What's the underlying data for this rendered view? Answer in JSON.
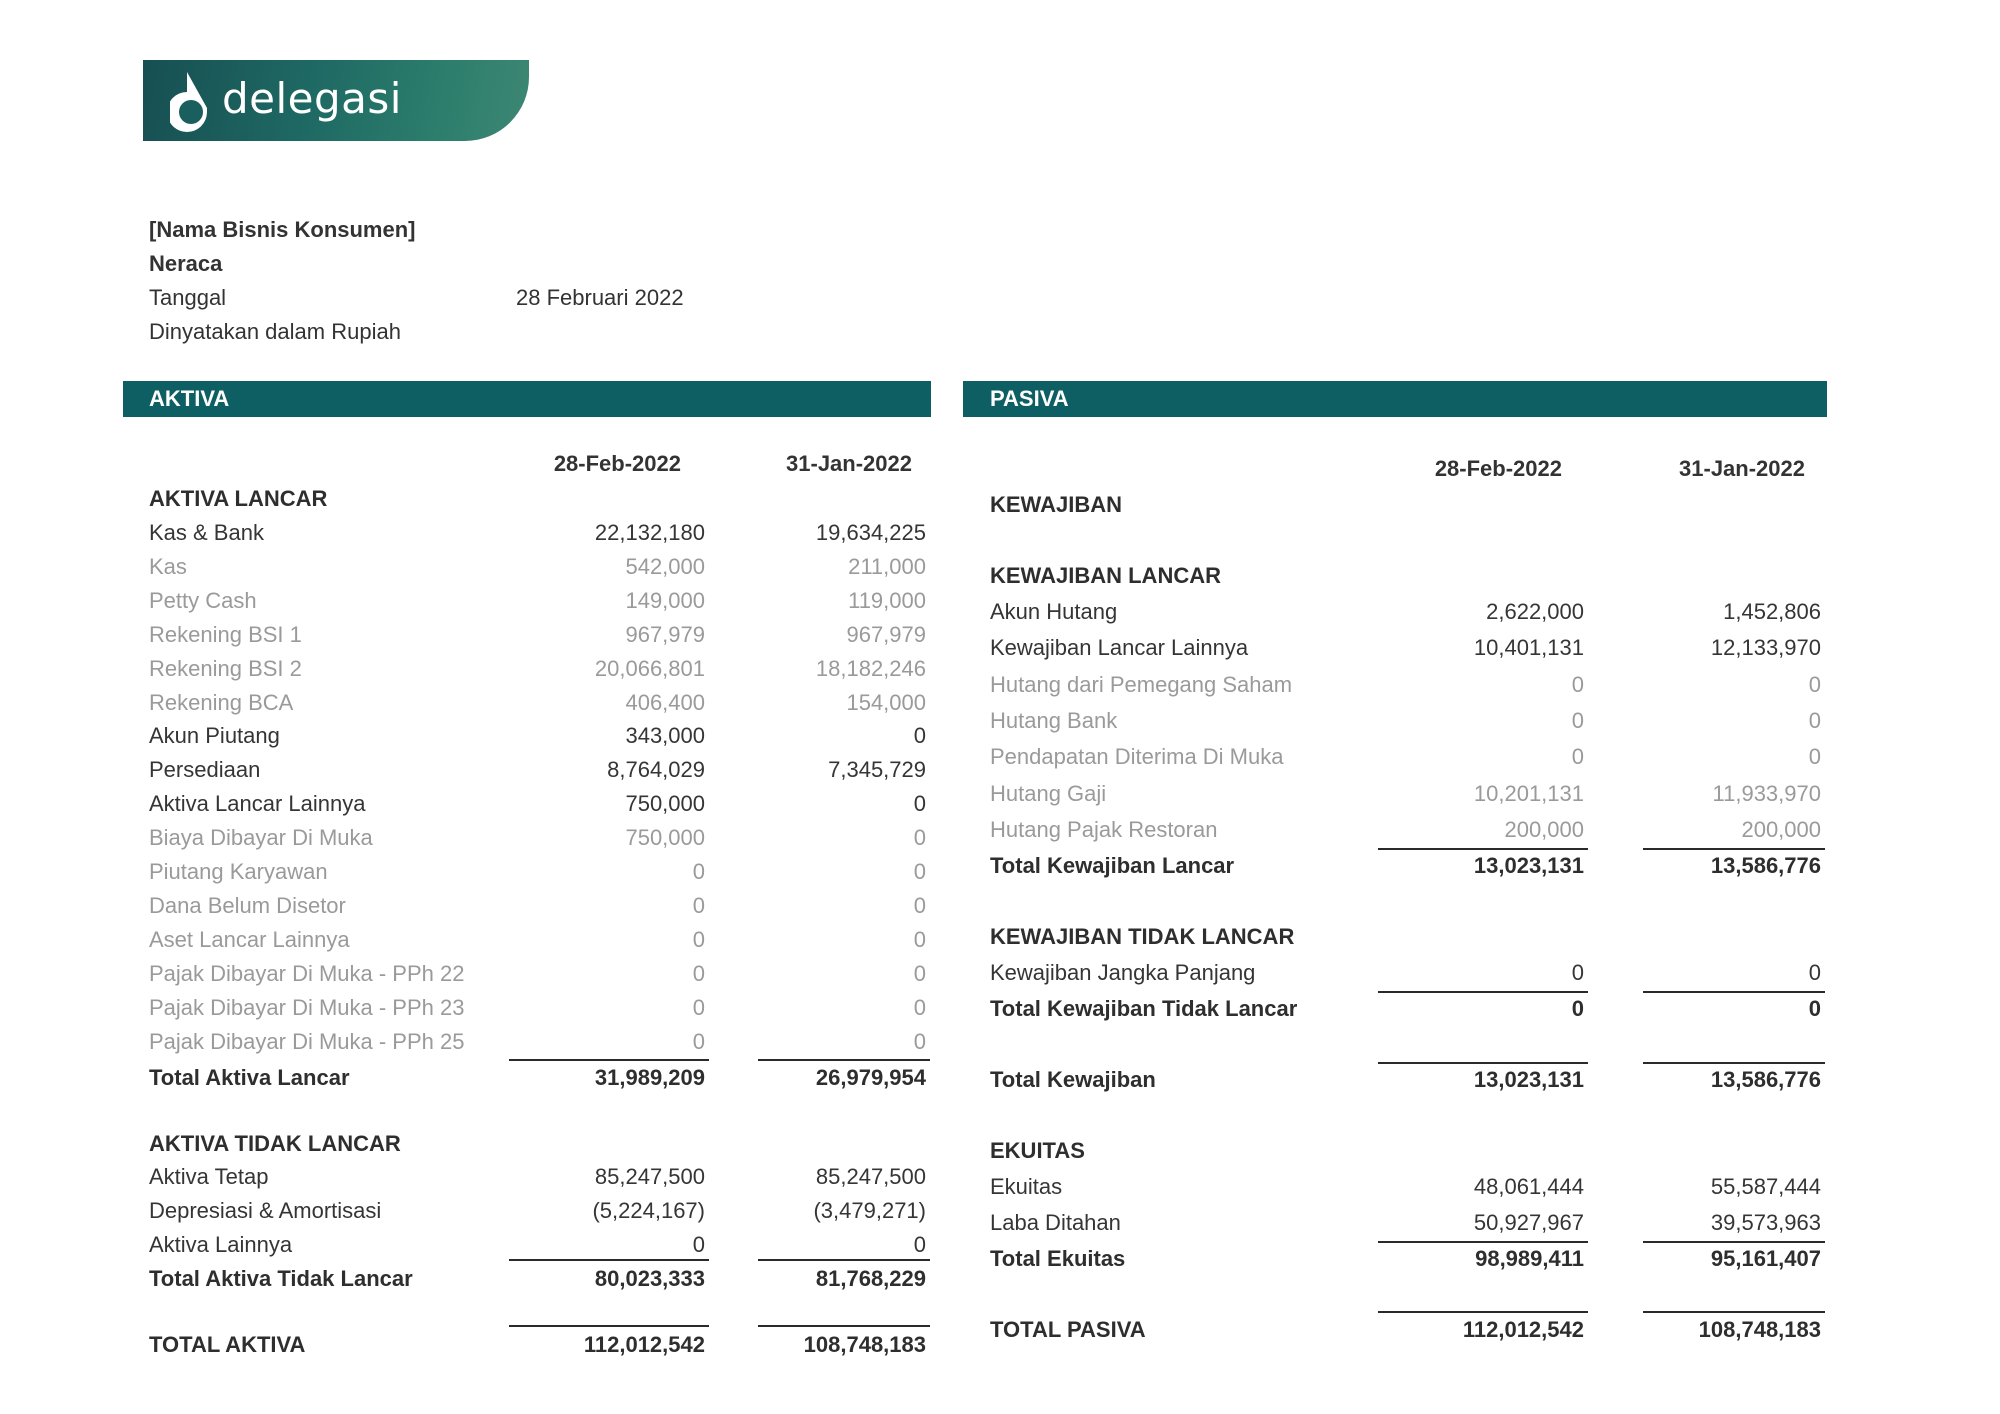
{
  "brand": {
    "name": "delegasi",
    "logo_icon": "delegasi-logo-icon"
  },
  "header": {
    "business_name": "[Nama Bisnis Konsumen]",
    "report_title": "Neraca",
    "date_label": "Tanggal",
    "date_value": "28 Februari 2022",
    "currency_note": "Dinyatakan dalam Rupiah"
  },
  "aktiva": {
    "title": "AKTIVA",
    "col1": "28-Feb-2022",
    "col2": "31-Jan-2022",
    "current_section": "AKTIVA LANCAR",
    "current_rows": [
      {
        "label": "Kas & Bank",
        "v1": "22,132,180",
        "v2": "19,634,225"
      },
      {
        "label": "Kas",
        "v1": "542,000",
        "v2": "211,000"
      },
      {
        "label": "Petty Cash",
        "v1": "149,000",
        "v2": "119,000"
      },
      {
        "label": "Rekening BSI 1",
        "v1": "967,979",
        "v2": "967,979"
      },
      {
        "label": "Rekening BSI 2",
        "v1": "20,066,801",
        "v2": "18,182,246"
      },
      {
        "label": "Rekening BCA",
        "v1": "406,400",
        "v2": "154,000"
      },
      {
        "label": "Akun Piutang",
        "v1": "343,000",
        "v2": "0"
      },
      {
        "label": "Persediaan",
        "v1": "8,764,029",
        "v2": "7,345,729"
      },
      {
        "label": "Aktiva Lancar Lainnya",
        "v1": "750,000",
        "v2": "0"
      },
      {
        "label": "Biaya Dibayar Di Muka",
        "v1": "750,000",
        "v2": "0"
      },
      {
        "label": "Piutang Karyawan",
        "v1": "0",
        "v2": "0"
      },
      {
        "label": "Dana Belum Disetor",
        "v1": "0",
        "v2": "0"
      },
      {
        "label": "Aset Lancar Lainnya",
        "v1": "0",
        "v2": "0"
      },
      {
        "label": "Pajak Dibayar Di Muka - PPh 22",
        "v1": "0",
        "v2": "0"
      },
      {
        "label": "Pajak Dibayar Di Muka - PPh 23",
        "v1": "0",
        "v2": "0"
      },
      {
        "label": "Pajak Dibayar Di Muka - PPh 25",
        "v1": "0",
        "v2": "0"
      }
    ],
    "current_total": {
      "label": "Total Aktiva Lancar",
      "v1": "31,989,209",
      "v2": "26,979,954"
    },
    "noncurrent_section": "AKTIVA TIDAK LANCAR",
    "noncurrent_rows": [
      {
        "label": "Aktiva Tetap",
        "v1": "85,247,500",
        "v2": "85,247,500"
      },
      {
        "label": "Depresiasi & Amortisasi",
        "v1": "(5,224,167)",
        "v2": "(3,479,271)"
      },
      {
        "label": "Aktiva Lainnya",
        "v1": "0",
        "v2": "0"
      }
    ],
    "noncurrent_total": {
      "label": "Total Aktiva Tidak Lancar",
      "v1": "80,023,333",
      "v2": "81,768,229"
    },
    "grand_total": {
      "label": "TOTAL AKTIVA",
      "v1": "112,012,542",
      "v2": "108,748,183"
    }
  },
  "pasiva": {
    "title": "PASIVA",
    "col1": "28-Feb-2022",
    "col2": "31-Jan-2022",
    "liabilities_section": "KEWAJIBAN",
    "current_section": "KEWAJIBAN LANCAR",
    "current_rows": [
      {
        "label": "Akun Hutang",
        "v1": "2,622,000",
        "v2": "1,452,806"
      },
      {
        "label": "Kewajiban Lancar Lainnya",
        "v1": "10,401,131",
        "v2": "12,133,970"
      },
      {
        "label": "Hutang dari Pemegang Saham",
        "v1": "0",
        "v2": "0"
      },
      {
        "label": "Hutang Bank",
        "v1": "0",
        "v2": "0"
      },
      {
        "label": "Pendapatan Diterima Di Muka",
        "v1": "0",
        "v2": "0"
      },
      {
        "label": "Hutang Gaji",
        "v1": "10,201,131",
        "v2": "11,933,970"
      },
      {
        "label": "Hutang Pajak Restoran",
        "v1": "200,000",
        "v2": "200,000"
      }
    ],
    "current_total": {
      "label": "Total Kewajiban Lancar",
      "v1": "13,023,131",
      "v2": "13,586,776"
    },
    "noncurrent_section": "KEWAJIBAN TIDAK LANCAR",
    "noncurrent_rows": [
      {
        "label": "Kewajiban Jangka Panjang",
        "v1": "0",
        "v2": "0"
      }
    ],
    "noncurrent_total": {
      "label": "Total Kewajiban Tidak Lancar",
      "v1": "0",
      "v2": "0"
    },
    "liabilities_total": {
      "label": "Total Kewajiban",
      "v1": "13,023,131",
      "v2": "13,586,776"
    },
    "equity_section": "EKUITAS",
    "equity_rows": [
      {
        "label": "Ekuitas",
        "v1": "48,061,444",
        "v2": "55,587,444"
      },
      {
        "label": "Laba Ditahan",
        "v1": "50,927,967",
        "v2": "39,573,963"
      }
    ],
    "equity_total": {
      "label": "Total Ekuitas",
      "v1": "98,989,411",
      "v2": "95,161,407"
    },
    "grand_total": {
      "label": "TOTAL PASIVA",
      "v1": "112,012,542",
      "v2": "108,748,183"
    }
  }
}
